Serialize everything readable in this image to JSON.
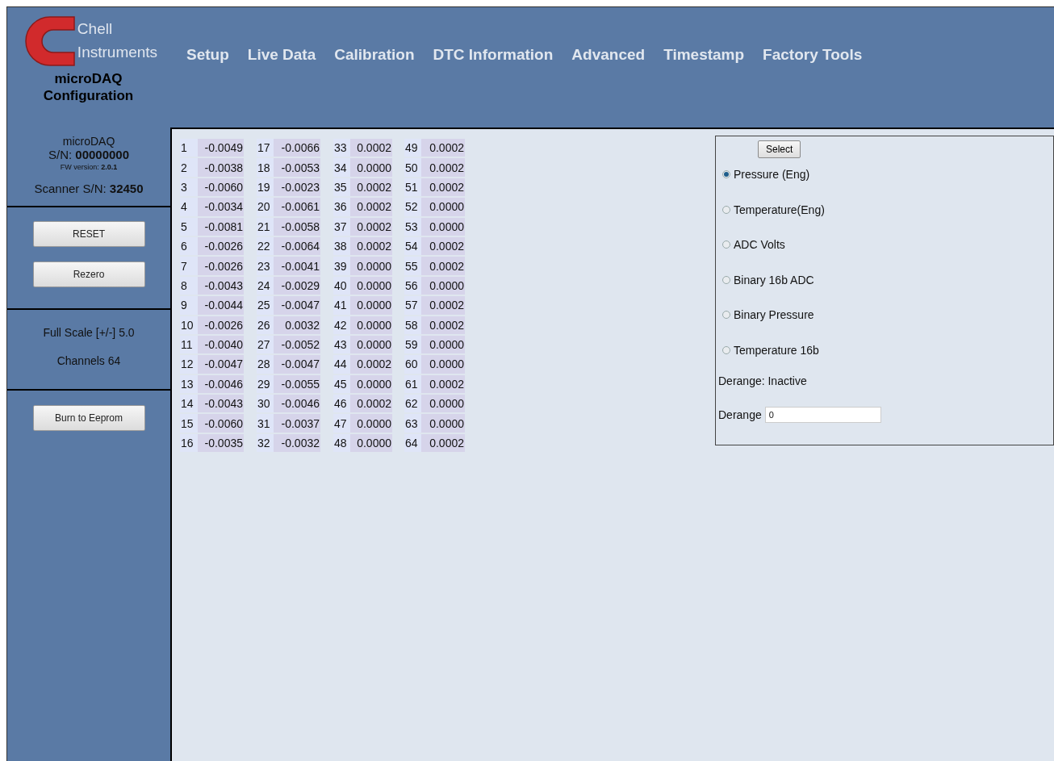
{
  "header": {
    "logo_line1": "Chell",
    "logo_line2": "Instruments",
    "app_title": "microDAQ Configuration",
    "nav": [
      {
        "label": "Setup"
      },
      {
        "label": "Live Data"
      },
      {
        "label": "Calibration"
      },
      {
        "label": "DTC Information"
      },
      {
        "label": "Advanced"
      },
      {
        "label": "Timestamp"
      },
      {
        "label": "Factory Tools"
      }
    ]
  },
  "sidebar": {
    "device": "microDAQ",
    "serial": "S/N:  **00000000**",
    "firmware": "FW version:  **2.0.1**",
    "scanner": "Scanner S/N:  **32450**",
    "buttons": [
      "RESET",
      "Rezero"
    ],
    "full_scale": "Full Scale [+/-]  5.0",
    "channel_count": "Channels  64",
    "burn_button": "Burn to Eeprom"
  },
  "channels": [
    {
      "number": "1",
      "value": "-0.0049"
    },
    {
      "number": "2",
      "value": "-0.0038"
    },
    {
      "number": "3",
      "value": "-0.0060"
    },
    {
      "number": "4",
      "value": "-0.0034"
    },
    {
      "number": "5",
      "value": "-0.0081"
    },
    {
      "number": "6",
      "value": "-0.0026"
    },
    {
      "number": "7",
      "value": "-0.0026"
    },
    {
      "number": "8",
      "value": "-0.0043"
    },
    {
      "number": "9",
      "value": "-0.0044"
    },
    {
      "number": "10",
      "value": "-0.0026"
    },
    {
      "number": "11",
      "value": "-0.0040"
    },
    {
      "number": "12",
      "value": "-0.0047"
    },
    {
      "number": "13",
      "value": "-0.0046"
    },
    {
      "number": "14",
      "value": "-0.0043"
    },
    {
      "number": "15",
      "value": "-0.0060"
    },
    {
      "number": "16",
      "value": "-0.0035"
    },
    {
      "number": "17",
      "value": "-0.0066"
    },
    {
      "number": "18",
      "value": "-0.0053"
    },
    {
      "number": "19",
      "value": "-0.0023"
    },
    {
      "number": "20",
      "value": "-0.0061"
    },
    {
      "number": "21",
      "value": "-0.0058"
    },
    {
      "number": "22",
      "value": "-0.0064"
    },
    {
      "number": "23",
      "value": "-0.0041"
    },
    {
      "number": "24",
      "value": "-0.0029"
    },
    {
      "number": "25",
      "value": "-0.0047"
    },
    {
      "number": "26",
      "value": "0.0032"
    },
    {
      "number": "27",
      "value": "-0.0052"
    },
    {
      "number": "28",
      "value": "-0.0047"
    },
    {
      "number": "29",
      "value": "-0.0055"
    },
    {
      "number": "30",
      "value": "-0.0046"
    },
    {
      "number": "31",
      "value": "-0.0037"
    },
    {
      "number": "32",
      "value": "-0.0032"
    },
    {
      "number": "33",
      "value": "0.0002"
    },
    {
      "number": "34",
      "value": "0.0000"
    },
    {
      "number": "35",
      "value": "0.0002"
    },
    {
      "number": "36",
      "value": "0.0002"
    },
    {
      "number": "37",
      "value": "0.0002"
    },
    {
      "number": "38",
      "value": "0.0002"
    },
    {
      "number": "39",
      "value": "0.0000"
    },
    {
      "number": "40",
      "value": "0.0000"
    },
    {
      "number": "41",
      "value": "0.0000"
    },
    {
      "number": "42",
      "value": "0.0000"
    },
    {
      "number": "43",
      "value": "0.0000"
    },
    {
      "number": "44",
      "value": "0.0002"
    },
    {
      "number": "45",
      "value": "0.0000"
    },
    {
      "number": "46",
      "value": "0.0002"
    },
    {
      "number": "47",
      "value": "0.0000"
    },
    {
      "number": "48",
      "value": "0.0000"
    },
    {
      "number": "49",
      "value": "0.0002"
    },
    {
      "number": "50",
      "value": "0.0002"
    },
    {
      "number": "51",
      "value": "0.0002"
    },
    {
      "number": "52",
      "value": "0.0000"
    },
    {
      "number": "53",
      "value": "0.0000"
    },
    {
      "number": "54",
      "value": "0.0002"
    },
    {
      "number": "55",
      "value": "0.0002"
    },
    {
      "number": "56",
      "value": "0.0000"
    },
    {
      "number": "57",
      "value": "0.0002"
    },
    {
      "number": "58",
      "value": "0.0002"
    },
    {
      "number": "59",
      "value": "0.0000"
    },
    {
      "number": "60",
      "value": "0.0000"
    },
    {
      "number": "61",
      "value": "0.0002"
    },
    {
      "number": "62",
      "value": "0.0000"
    },
    {
      "number": "63",
      "value": "0.0000"
    },
    {
      "number": "64",
      "value": "0.0002"
    }
  ],
  "output_panel": {
    "select_button": "Select",
    "modes": [
      {
        "label": "Pressure (Eng)",
        "selected": true
      },
      {
        "label": "Temperature(Eng)",
        "selected": false
      },
      {
        "label": "ADC Volts",
        "selected": false
      },
      {
        "label": "Binary 16b ADC",
        "selected": false
      },
      {
        "label": "Binary Pressure",
        "selected": false
      },
      {
        "label": "Temperature 16b",
        "selected": false
      }
    ],
    "derange_status": "Derange: Inactive",
    "derange_label": "Derange",
    "derange_value": "0"
  }
}
